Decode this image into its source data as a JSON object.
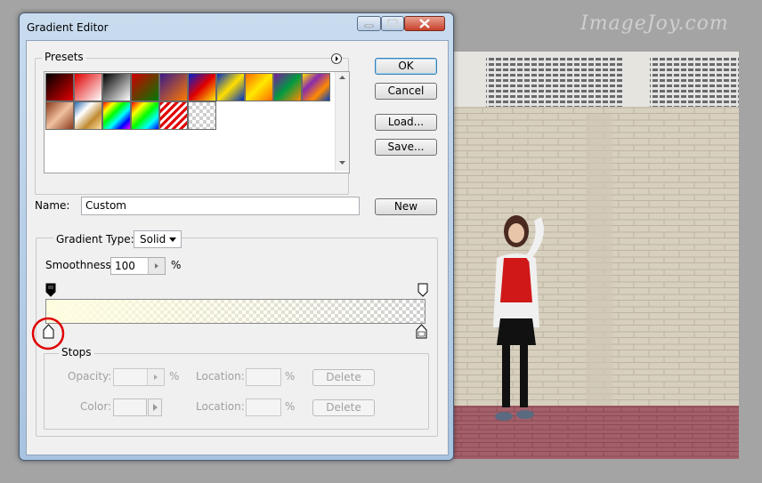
{
  "watermark": "ImageJoy.com",
  "window": {
    "title": "Gradient Editor"
  },
  "presets": {
    "label": "Presets",
    "swatches": [
      {
        "name": "foreground-to-background",
        "bg": "linear-gradient(135deg,#000 0%,#e00000 100%)"
      },
      {
        "name": "foreground-to-transparent",
        "bg": "linear-gradient(135deg,#e00000 0%,rgba(224,0,0,0) 100%)"
      },
      {
        "name": "black-white",
        "bg": "linear-gradient(135deg,#000,#fff)"
      },
      {
        "name": "red-green",
        "bg": "linear-gradient(135deg,#d00000,#007a00)"
      },
      {
        "name": "violet-orange",
        "bg": "linear-gradient(135deg,#3a1a8a,#ff7a00)"
      },
      {
        "name": "blue-red-yellow",
        "bg": "linear-gradient(135deg,#0020d0,#e00000,#ffe800)"
      },
      {
        "name": "blue-yellow-blue",
        "bg": "linear-gradient(135deg,#0030c0,#ffe000,#0030c0)"
      },
      {
        "name": "orange-yellow-orange",
        "bg": "linear-gradient(135deg,#ff6a00,#ffe800,#ff6a00)"
      },
      {
        "name": "violet-green-orange",
        "bg": "linear-gradient(135deg,#7a1aa0,#009a40,#ff8a00)"
      },
      {
        "name": "yellow-violet-orange-blue",
        "bg": "linear-gradient(135deg,#ffe000,#8a2ab0,#ff8a00,#0040c0)"
      },
      {
        "name": "copper",
        "bg": "linear-gradient(135deg,#8a3a1a,#f0c0a0,#8a3a1a)"
      },
      {
        "name": "chrome",
        "bg": "linear-gradient(135deg,#2a6ab0,#ffffff,#c08a30,#ffe0a0)"
      },
      {
        "name": "spectrum",
        "bg": "linear-gradient(135deg,#ff0000,#ffff00,#00ff00,#00ffff,#0000ff,#ff00ff)"
      },
      {
        "name": "transparent-rainbow",
        "bg": "linear-gradient(135deg,#ff0000,#ffff00,#00ff00,#00ffff,#0000ff)"
      },
      {
        "name": "transparent-stripes",
        "bg": "repeating-linear-gradient(135deg,#e00000 0 3px,#ffffff 3px 6px)"
      },
      {
        "name": "neutral-density",
        "bg": "checker"
      }
    ]
  },
  "buttons": {
    "ok": "OK",
    "cancel": "Cancel",
    "load": "Load...",
    "save": "Save...",
    "new": "New",
    "delete_opacity": "Delete",
    "delete_color": "Delete"
  },
  "name": {
    "label": "Name:",
    "value": "Custom"
  },
  "gradient_type": {
    "label": "Gradient Type:",
    "value": "Solid"
  },
  "smoothness": {
    "label": "Smoothness:",
    "value": "100",
    "unit": "%"
  },
  "gradient": {
    "start_color": "#fffde0",
    "end_color": "transparent"
  },
  "stops": {
    "label": "Stops",
    "opacity_label": "Opacity:",
    "opacity_unit": "%",
    "color_label": "Color:",
    "location_label_1": "Location:",
    "location_unit_1": "%",
    "location_label_2": "Location:",
    "location_unit_2": "%"
  },
  "colors": {
    "highlight_circle": "#e00000",
    "default_button_border": "#3c7fb1"
  }
}
